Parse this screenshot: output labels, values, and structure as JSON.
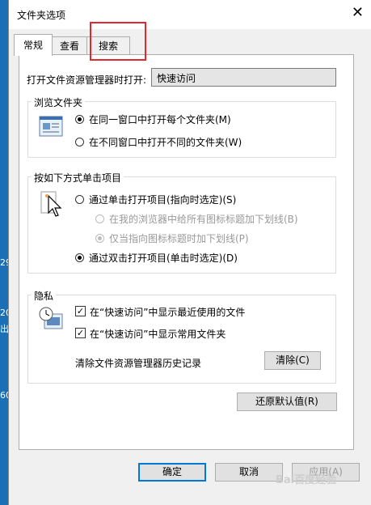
{
  "desktop": {
    "fragments": [
      "29",
      "20",
      "出",
      "60"
    ]
  },
  "window": {
    "title": "文件夹选项"
  },
  "tabs": [
    {
      "label": "常规"
    },
    {
      "label": "查看"
    },
    {
      "label": "搜索"
    }
  ],
  "general": {
    "open_label": "打开文件资源管理器时打开:",
    "open_value": "快速访问",
    "browse": {
      "title": "浏览文件夹",
      "opt_same": "在同一窗口中打开每个文件夹(M)",
      "opt_new": "在不同窗口中打开不同的文件夹(W)"
    },
    "click": {
      "title": "按如下方式单击项目",
      "opt_single": "通过单击打开项目(指向时选定)(S)",
      "sub_all": "在我的浏览器中给所有图标标题加下划线(B)",
      "sub_point": "仅当指向图标标题时加下划线(P)",
      "opt_double": "通过双击打开项目(单击时选定)(D)"
    },
    "privacy": {
      "title": "隐私",
      "recent_files": "在“快速访问”中显示最近使用的文件",
      "frequent_folders": "在“快速访问”中显示常用文件夹",
      "clear_label": "清除文件资源管理器历史记录",
      "clear_button": "清除(C)"
    },
    "restore_button": "还原默认值(R)"
  },
  "footer": {
    "ok": "确定",
    "cancel": "取消",
    "apply": "应用(A)"
  },
  "watermark": "Bai百度经验"
}
